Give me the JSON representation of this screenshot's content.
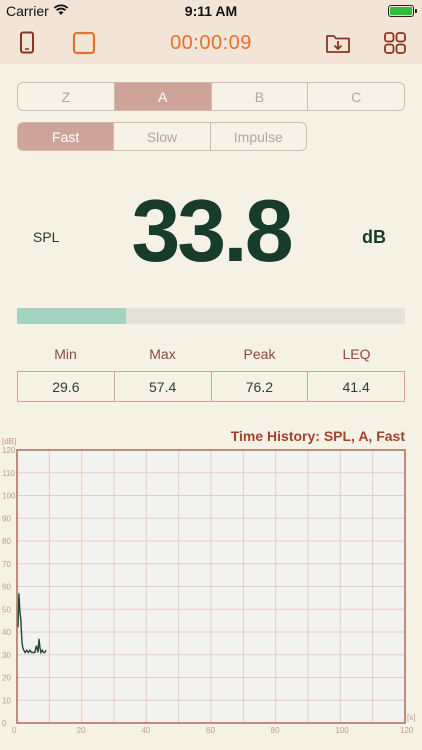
{
  "status_bar": {
    "carrier": "Carrier",
    "time": "9:11 AM"
  },
  "toolbar": {
    "timer": "00:00:09",
    "icons": [
      "phone-outline-icon",
      "stop-square-icon",
      "download-folder-icon",
      "grid-menu-icon"
    ],
    "accent_color": "#e2712a"
  },
  "weighting": {
    "options": [
      "Z",
      "A",
      "B",
      "C"
    ],
    "selected": "A"
  },
  "response": {
    "options": [
      "Fast",
      "Slow",
      "Impulse"
    ],
    "selected": "Fast"
  },
  "readout": {
    "label": "SPL",
    "value": "33.8",
    "unit": "dB",
    "level_fraction": 0.28
  },
  "stats": {
    "headers": [
      "Min",
      "Max",
      "Peak",
      "LEQ"
    ],
    "values": [
      "29.6",
      "57.4",
      "76.2",
      "41.4"
    ]
  },
  "chart_data": {
    "type": "line",
    "title": "Time History: SPL, A, Fast",
    "ylabel": "[dB]",
    "xlabel": "[s]",
    "xlim": [
      0,
      120
    ],
    "ylim": [
      0,
      120
    ],
    "x_ticks": [
      0,
      20,
      40,
      60,
      80,
      100,
      120
    ],
    "y_ticks": [
      0,
      10,
      20,
      30,
      40,
      50,
      60,
      70,
      80,
      90,
      100,
      110,
      120
    ],
    "grid": true,
    "line_color": "#1f4a34",
    "series": [
      {
        "x": [
          0.3,
          0.6,
          0.9,
          1.2,
          1.5,
          1.8,
          2.1,
          2.5,
          3.0,
          3.5,
          4.0,
          4.5,
          5.0,
          5.5,
          6.0,
          6.5,
          6.8,
          7.1,
          7.4,
          7.8,
          8.2,
          8.6,
          9.0
        ],
        "y": [
          42,
          57,
          49,
          45,
          36,
          33,
          32,
          31,
          32,
          31,
          32,
          31,
          31,
          31,
          34,
          31,
          37,
          33,
          31,
          32,
          31,
          31,
          32
        ]
      }
    ]
  }
}
